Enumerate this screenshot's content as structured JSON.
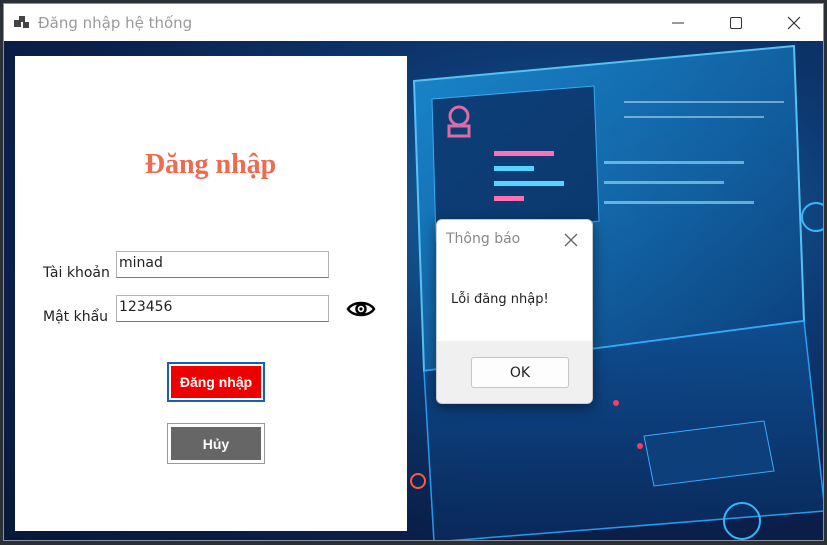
{
  "window": {
    "title": "Đăng nhập hệ thống",
    "app_icon": "app-window-icon",
    "controls": [
      "minimize-icon",
      "maximize-icon",
      "close-icon"
    ]
  },
  "login": {
    "title": "Đăng nhập",
    "username_label": "Tài khoản",
    "username_value": "minad",
    "password_label": "Mật khẩu",
    "password_value": "123456",
    "show_password_icon": "eye-icon",
    "login_button": "Đăng nhập",
    "cancel_button": "Hủy"
  },
  "dialog": {
    "title": "Thông báo",
    "message": "Lỗi đăng nhập!",
    "ok_button": "OK",
    "close_icon": "close-icon"
  },
  "colors": {
    "title_accent": "#ef6b50",
    "login_button_bg": "#ee0000",
    "cancel_button_bg": "#666666",
    "background_blue": "#0d3a73"
  }
}
